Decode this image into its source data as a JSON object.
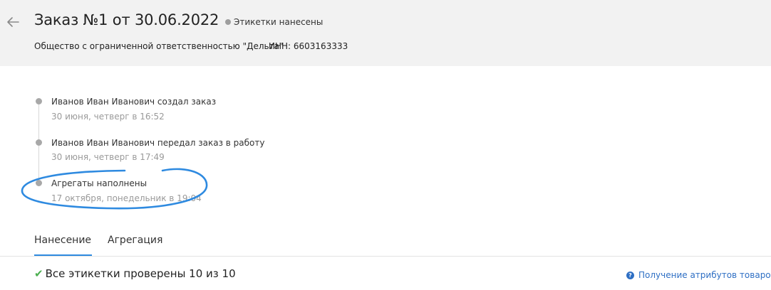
{
  "header": {
    "title": "Заказ №1 от 30.06.2022",
    "status": "Этикетки нанесены",
    "organization": "Общество с ограниченной ответственностью \"Дельта\"",
    "inn": "ИНН: 6603163333"
  },
  "timeline": [
    {
      "title": "Иванов Иван Иванович создал заказ",
      "time": "30 июня, четверг в 16:52"
    },
    {
      "title": "Иванов Иван Иванович передал заказ в работу",
      "time": "30 июня, четверг в 17:49"
    },
    {
      "title": "Агрегаты наполнены",
      "time": "17 октября, понедельник в 19:04"
    }
  ],
  "tabs": [
    {
      "label": "Нанесение",
      "active": true
    },
    {
      "label": "Агрегация",
      "active": false
    }
  ],
  "summary": {
    "text": "Все этикетки проверены 10 из 10"
  },
  "help": {
    "label": "Получение атрибутов товаров"
  },
  "colors": {
    "header_bg": "#f2f2f2",
    "accent": "#2e8ae0",
    "link": "#2e6fc4",
    "success": "#4caf50",
    "annotation": "#2e8ae0"
  }
}
